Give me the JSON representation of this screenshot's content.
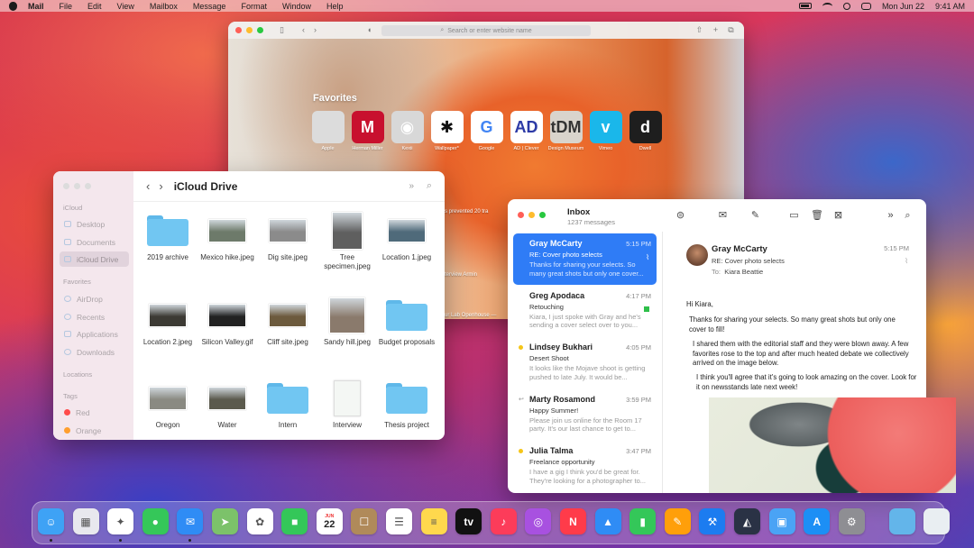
{
  "menubar": {
    "app": "Mail",
    "items": [
      "File",
      "Edit",
      "View",
      "Mailbox",
      "Message",
      "Format",
      "Window",
      "Help"
    ],
    "date": "Mon Jun 22",
    "time": "9:41 AM"
  },
  "safari": {
    "address_placeholder": "Search or enter website name",
    "favorites_title": "Favorites",
    "favorites": [
      {
        "label": "Apple",
        "glyph": "",
        "bg": "#dcdcdc",
        "fg": "#333333",
        "icon": "apple-icon"
      },
      {
        "label": "Herman Miller",
        "glyph": "M",
        "bg": "#c8102e",
        "fg": "#ffffff",
        "icon": "herman-miller-icon"
      },
      {
        "label": "Kexii",
        "glyph": "◉",
        "bg": "#d8d8d8",
        "fg": "#ffffff",
        "icon": "kexii-icon"
      },
      {
        "label": "Wallpaper*",
        "glyph": "✱",
        "bg": "#ffffff",
        "fg": "#111111",
        "icon": "wallpaper-icon"
      },
      {
        "label": "Google",
        "glyph": "G",
        "bg": "#ffffff",
        "fg": "#4285f4",
        "icon": "google-icon"
      },
      {
        "label": "AD | Clever",
        "glyph": "AD",
        "bg": "#ffffff",
        "fg": "#2c3aa6",
        "icon": "ad-clever-icon"
      },
      {
        "label": "Design Museum",
        "glyph": "tDM",
        "bg": "#d9d4cc",
        "fg": "#333333",
        "icon": "design-museum-icon"
      },
      {
        "label": "Vimeo",
        "glyph": "v",
        "bg": "#1ab7ea",
        "fg": "#ffffff",
        "icon": "vimeo-icon"
      },
      {
        "label": "Dwell",
        "glyph": "d",
        "bg": "#1e1e1e",
        "fg": "#ffffff",
        "icon": "dwell-icon"
      }
    ],
    "peek_texts": [
      "s prevented 20 tra",
      "terview Armin",
      "ur Lab Openhouse —"
    ]
  },
  "finder": {
    "title": "iCloud Drive",
    "sidebar": {
      "icloud_header": "iCloud",
      "icloud_items": [
        "Desktop",
        "Documents",
        "iCloud Drive"
      ],
      "favorites_header": "Favorites",
      "favorite_items": [
        "AirDrop",
        "Recents",
        "Applications",
        "Downloads"
      ],
      "locations_header": "Locations",
      "tags_header": "Tags",
      "tags": [
        {
          "label": "Red",
          "color": "#ff4b4b"
        },
        {
          "label": "Orange",
          "color": "#ff9f2e"
        }
      ]
    },
    "items": [
      {
        "name": "2019 archive",
        "kind": "folder"
      },
      {
        "name": "Mexico hike.jpeg",
        "kind": "photo",
        "color": "#6d7a6a"
      },
      {
        "name": "Dig site.jpeg",
        "kind": "photo",
        "color": "#8b8b8b"
      },
      {
        "name": "Tree specimen.jpeg",
        "kind": "photo-tall",
        "color": "#5f5f5f"
      },
      {
        "name": "Location 1.jpeg",
        "kind": "photo",
        "color": "#4f6a7a"
      },
      {
        "name": "Location 2.jpeg",
        "kind": "photo",
        "color": "#3c3a34"
      },
      {
        "name": "Silicon Valley.gif",
        "kind": "photo",
        "color": "#222222"
      },
      {
        "name": "Cliff site.jpeg",
        "kind": "photo",
        "color": "#6c5a3d"
      },
      {
        "name": "Sandy hill.jpeg",
        "kind": "photo-square",
        "color": "#8a7a6c"
      },
      {
        "name": "Budget proposals",
        "kind": "folder"
      },
      {
        "name": "Oregon",
        "kind": "photo",
        "color": "#8a8a82"
      },
      {
        "name": "Water",
        "kind": "photo",
        "color": "#5b5a4d"
      },
      {
        "name": "Intern",
        "kind": "folder"
      },
      {
        "name": "Interview",
        "kind": "document"
      },
      {
        "name": "Thesis project",
        "kind": "folder"
      }
    ]
  },
  "mail": {
    "mailbox": "Inbox",
    "count": "1237 messages",
    "messages": [
      {
        "from": "Gray McCarty",
        "time": "5:15 PM",
        "subject": "RE: Cover photo selects",
        "preview": "Thanks for sharing your selects. So many great shots but only one cover...",
        "selected": true,
        "mark": "none",
        "attachment": true
      },
      {
        "from": "Greg Apodaca",
        "time": "4:17 PM",
        "subject": "Retouching",
        "preview": "Kiara, I just spoke with Gray and he's sending a cover select over to you...",
        "selected": false,
        "mark": "none",
        "flag": true
      },
      {
        "from": "Lindsey Bukhari",
        "time": "4:05 PM",
        "subject": "Desert Shoot",
        "preview": "It looks like the Mojave shoot is getting pushed to late July. It would be...",
        "selected": false,
        "mark": "star"
      },
      {
        "from": "Marty Rosamond",
        "time": "3:59 PM",
        "subject": "Happy Summer!",
        "preview": "Please join us online for the Room 17 party. It's our last chance to get to...",
        "selected": false,
        "mark": "reply"
      },
      {
        "from": "Julia Talma",
        "time": "3:47 PM",
        "subject": "Freelance opportunity",
        "preview": "I have a gig I think you'd be great for. They're looking for a photographer to...",
        "selected": false,
        "mark": "star"
      }
    ],
    "viewer": {
      "from": "Gray McCarty",
      "subject": "RE: Cover photo selects",
      "to_label": "To:",
      "to": "Kiara Beattie",
      "time": "5:15 PM",
      "greeting": "Hi Kiara,",
      "p1": "Thanks for sharing your selects. So many great shots but only one cover to fill!",
      "p2": "I shared them with the editorial staff and they were blown away. A few favorites rose to the top and after much heated debate we collectively arrived on the image below.",
      "p3": "I think you'll agree that it's going to look amazing on the cover. Look for it on newsstands late next week!"
    }
  },
  "dock": {
    "calendar_month": "JUN",
    "calendar_day": "22",
    "apps": [
      {
        "name": "finder-icon",
        "bg": "#3ea2f5",
        "glyph": "☺",
        "running": true
      },
      {
        "name": "launchpad-icon",
        "bg": "#e8e8ee",
        "glyph": "▦",
        "running": false
      },
      {
        "name": "safari-icon",
        "bg": "#ffffff",
        "glyph": "✦",
        "running": true
      },
      {
        "name": "messages-icon",
        "bg": "#35c759",
        "glyph": "●",
        "running": false
      },
      {
        "name": "mail-icon",
        "bg": "#2f8cf5",
        "glyph": "✉",
        "running": true
      },
      {
        "name": "maps-icon",
        "bg": "#7cc26a",
        "glyph": "➤",
        "running": false
      },
      {
        "name": "photos-icon",
        "bg": "#ffffff",
        "glyph": "✿",
        "running": false
      },
      {
        "name": "facetime-icon",
        "bg": "#34c759",
        "glyph": "■",
        "running": false
      },
      {
        "name": "calendar-icon",
        "bg": "#ffffff",
        "glyph": "",
        "running": false
      },
      {
        "name": "contacts-icon",
        "bg": "#b08a5a",
        "glyph": "☐",
        "running": false
      },
      {
        "name": "reminders-icon",
        "bg": "#ffffff",
        "glyph": "☰",
        "running": false
      },
      {
        "name": "notes-icon",
        "bg": "#ffd84d",
        "glyph": "≡",
        "running": false
      },
      {
        "name": "apple-tv-icon",
        "bg": "#111111",
        "glyph": "tv",
        "running": false
      },
      {
        "name": "music-icon",
        "bg": "#fc3c5a",
        "glyph": "♪",
        "running": false
      },
      {
        "name": "podcasts-icon",
        "bg": "#a851e0",
        "glyph": "◎",
        "running": false
      },
      {
        "name": "news-icon",
        "bg": "#ff3b4a",
        "glyph": "N",
        "running": false
      },
      {
        "name": "keynote-icon",
        "bg": "#2f8cf5",
        "glyph": "▲",
        "running": false
      },
      {
        "name": "numbers-icon",
        "bg": "#34c759",
        "glyph": "▮",
        "running": false
      },
      {
        "name": "pages-icon",
        "bg": "#ff9f0a",
        "glyph": "✎",
        "running": false
      },
      {
        "name": "xcode-icon",
        "bg": "#1c7cf0",
        "glyph": "⚒",
        "running": false
      },
      {
        "name": "instruments-icon",
        "bg": "#2a3245",
        "glyph": "◭",
        "running": false
      },
      {
        "name": "preview-icon",
        "bg": "#4aa3f5",
        "glyph": "▣",
        "running": false
      },
      {
        "name": "app-store-icon",
        "bg": "#1c8ff5",
        "glyph": "A",
        "running": false
      },
      {
        "name": "system-preferences-icon",
        "bg": "#8e8e93",
        "glyph": "⚙",
        "running": false
      },
      {
        "name": "downloads-folder-icon",
        "bg": "#63b5ea",
        "glyph": "",
        "running": false
      },
      {
        "name": "trash-icon",
        "bg": "#e9eef2",
        "glyph": "",
        "running": false
      }
    ]
  }
}
